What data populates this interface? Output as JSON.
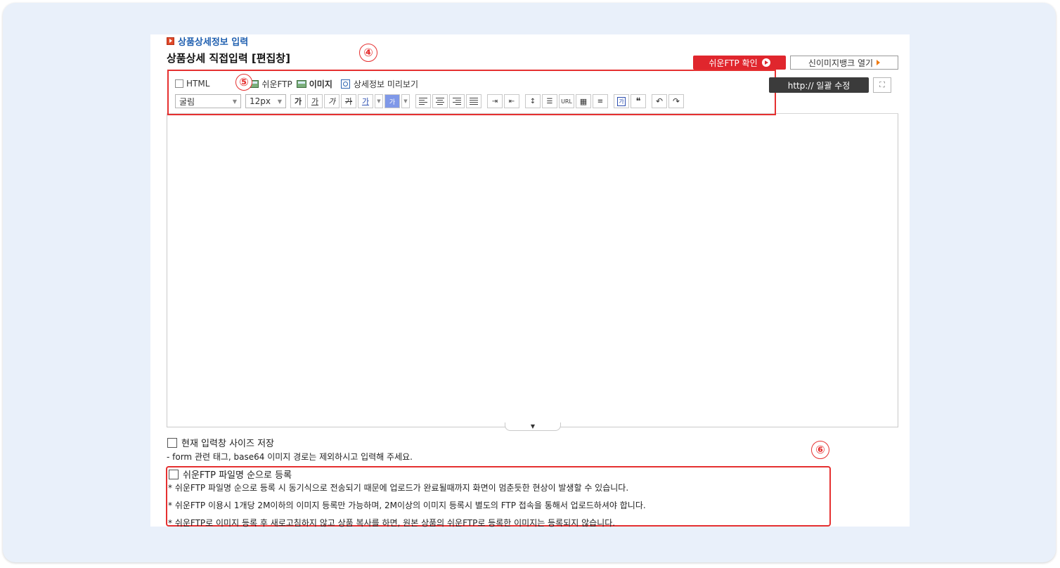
{
  "section": {
    "title": "상품상세정보 입력"
  },
  "editor": {
    "title": "상품상세 직접입력 [편집창]",
    "annotations": [
      "④",
      "⑤",
      "⑥"
    ],
    "buttons": {
      "ftp_check": "쉬운FTP 확인",
      "image_bank": "신이미지뱅크 열기",
      "http_fix": "http:// 일괄 수정",
      "fullscreen": "⛶"
    },
    "toolbar_row1": {
      "html_label": "HTML",
      "ftp_label": "쉬운FTP",
      "image_label": "이미지",
      "preview_label": "상세정보 미리보기"
    },
    "toolbar_row2": {
      "font": "굴림",
      "size": "12px",
      "bold": "가",
      "underline": "가",
      "italic": "가",
      "strike": "가",
      "font_color": "가",
      "bg_color": "가",
      "url": "URL",
      "quote": "❝",
      "undo": "↶",
      "redo": "↷"
    }
  },
  "options": {
    "save_size_label": "현재 입력창 사이즈 저장",
    "note": "- form 관련 태그, base64 이미지 경로는 제외하시고 입력해 주세요.",
    "ftp_order_label": "쉬운FTP 파일명 순으로 등록",
    "notices": [
      "* 쉬운FTP 파일명 순으로 등록 시 동기식으로 전송되기 때문에 업로드가 완료될때까지 화면이 멈춘듯한 현상이 발생할 수 있습니다.",
      "* 쉬운FTP 이용시 1개당 2M이하의 이미지 등록만 가능하며, 2M이상의 이미지 등록시 별도의 FTP 접속을 통해서 업로드하셔야 합니다.",
      "* 쉬운FTP로 이미지 등록 후 새로고침하지 않고 상품 복사를 하면, 원본 상품의 쉬운FTP로 등록한 이미지는 등록되지 않습니다."
    ]
  },
  "colors": {
    "accent_red": "#e0262d",
    "link_blue": "#1f5fb0",
    "annotation_red": "#e53030"
  }
}
